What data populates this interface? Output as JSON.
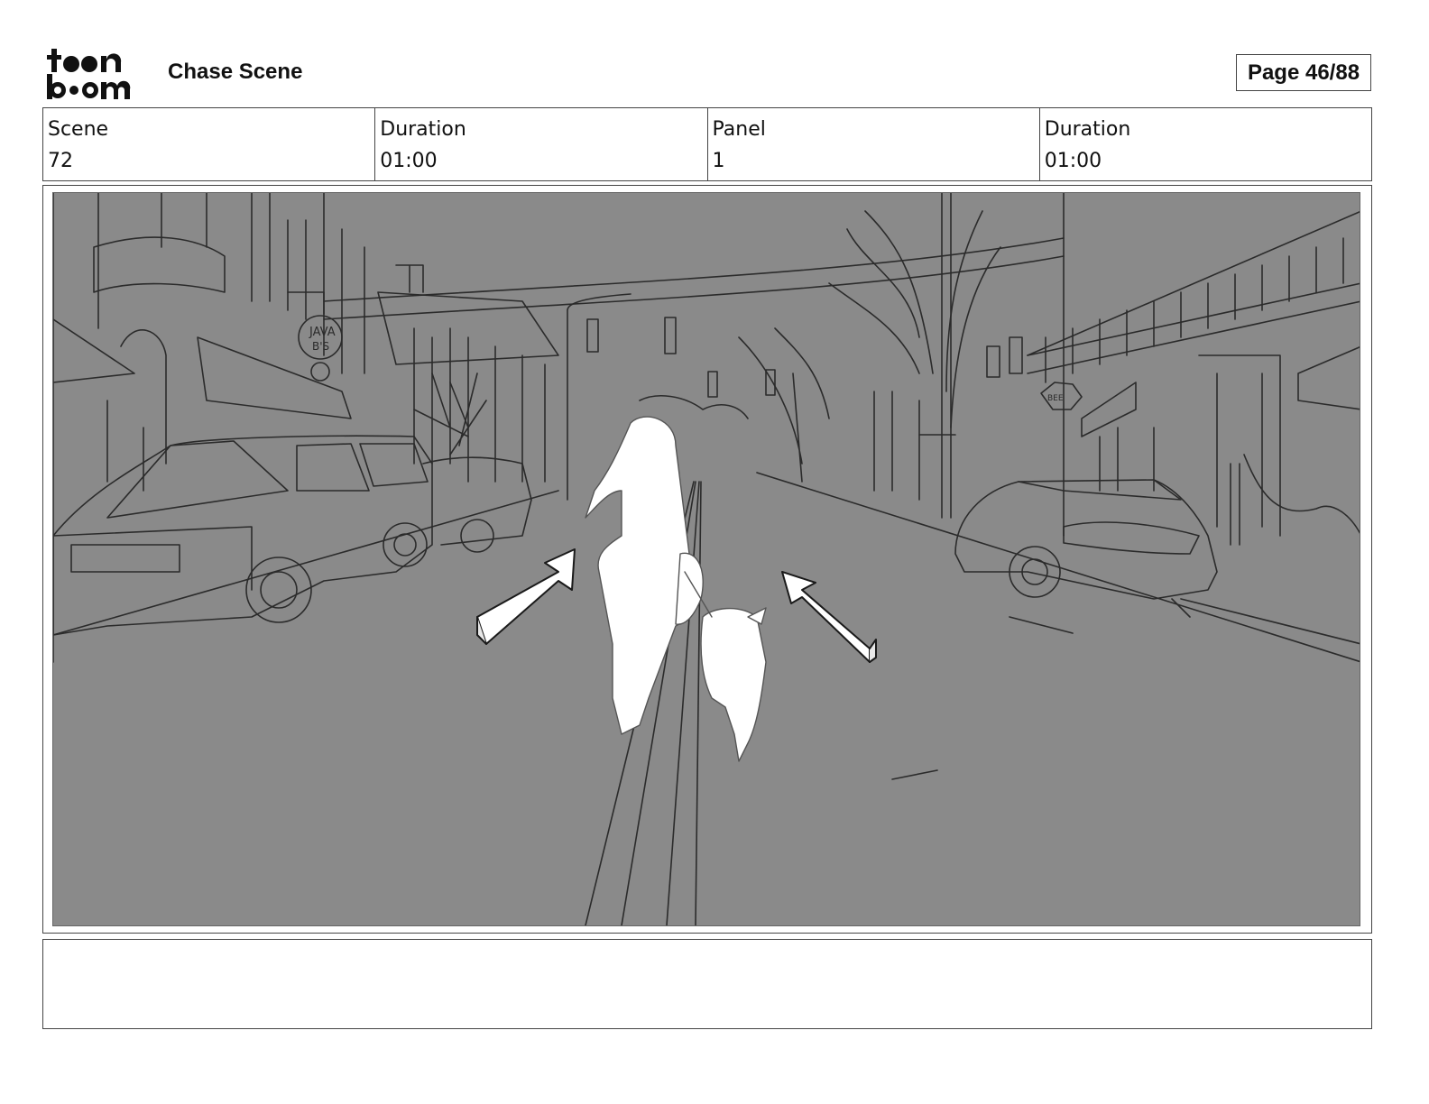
{
  "header": {
    "brand": "toon boom",
    "title": "Chase Scene",
    "page_label": "Page 46/88"
  },
  "info": [
    {
      "label": "Scene",
      "value": "72"
    },
    {
      "label": "Duration",
      "value": "01:00"
    },
    {
      "label": "Panel",
      "value": "1"
    },
    {
      "label": "Duration",
      "value": "01:00"
    }
  ],
  "panel": {
    "sign_text": "JAVA B'S",
    "sign_word_1": "JAVA",
    "sign_word_2": "B'S",
    "small_sign": "BEE"
  },
  "notes": "",
  "colors": {
    "panel_bg": "#8a8a8a",
    "sketch_line": "#2b2b2b",
    "figure": "#ffffff",
    "border": "#444444"
  }
}
